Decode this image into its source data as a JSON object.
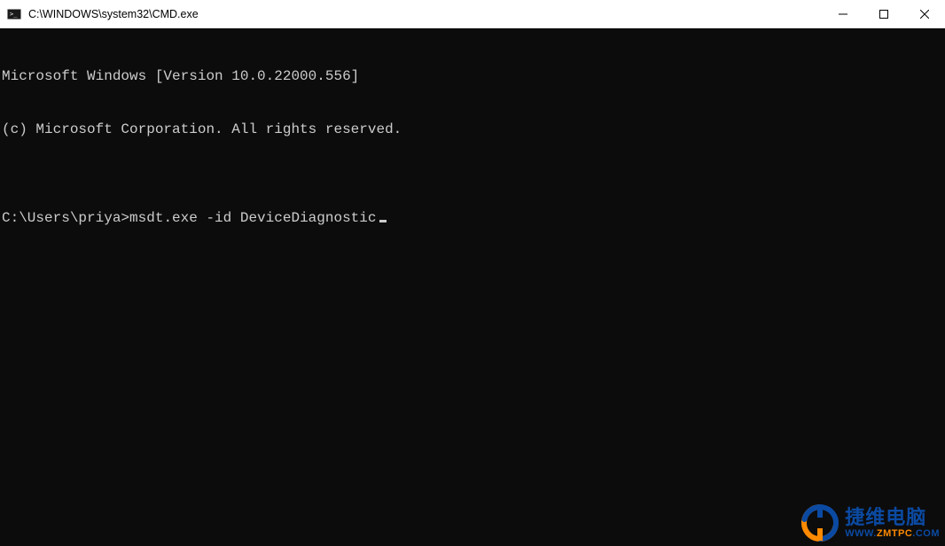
{
  "titlebar": {
    "title": "C:\\WINDOWS\\system32\\CMD.exe"
  },
  "terminal": {
    "line1": "Microsoft Windows [Version 10.0.22000.556]",
    "line2": "(c) Microsoft Corporation. All rights reserved.",
    "blank": "",
    "prompt": "C:\\Users\\priya>",
    "command": "msdt.exe -id DeviceDiagnostic"
  },
  "watermark": {
    "cn": "捷维电脑",
    "url_1": "WWW.",
    "url_2": "ZMTPC",
    "url_3": ".COM"
  }
}
